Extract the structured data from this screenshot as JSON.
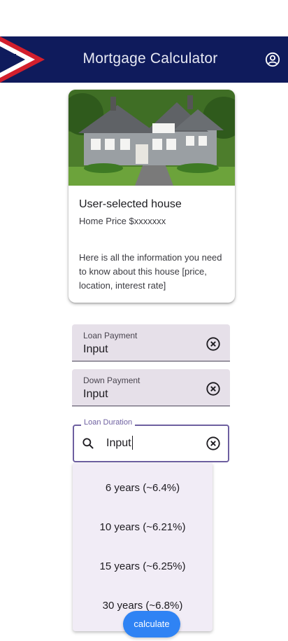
{
  "app_bar": {
    "title": "Mortgage Calculator",
    "menu_icon": "menu-icon",
    "account_icon": "account-circle-icon",
    "flag_colors": {
      "navy": "#0f1b5c",
      "red": "#d21f2d",
      "white": "#ffffff"
    }
  },
  "house_card": {
    "title": "User-selected house",
    "subtitle": "Home Price $xxxxxxx",
    "description": "Here is all the information you need to know about this house [price, location, interest rate]"
  },
  "form": {
    "loan_payment": {
      "label": "Loan Payment",
      "value": "Input",
      "clear_icon": "cancel-icon"
    },
    "down_payment": {
      "label": "Down Payment",
      "value": "Input",
      "clear_icon": "cancel-icon"
    },
    "loan_duration": {
      "label": "Loan Duration",
      "value": "Input",
      "search_icon": "search-icon",
      "clear_icon": "cancel-icon"
    }
  },
  "duration_options": [
    "6 years (~6.4%)",
    "10 years (~6.21%)",
    "15 years (~6.25%)",
    "30 years (~6.8%)"
  ],
  "calculate_button": {
    "label": "calculate",
    "color": "#2f83f4"
  },
  "accent_color": "#6d5fa0"
}
